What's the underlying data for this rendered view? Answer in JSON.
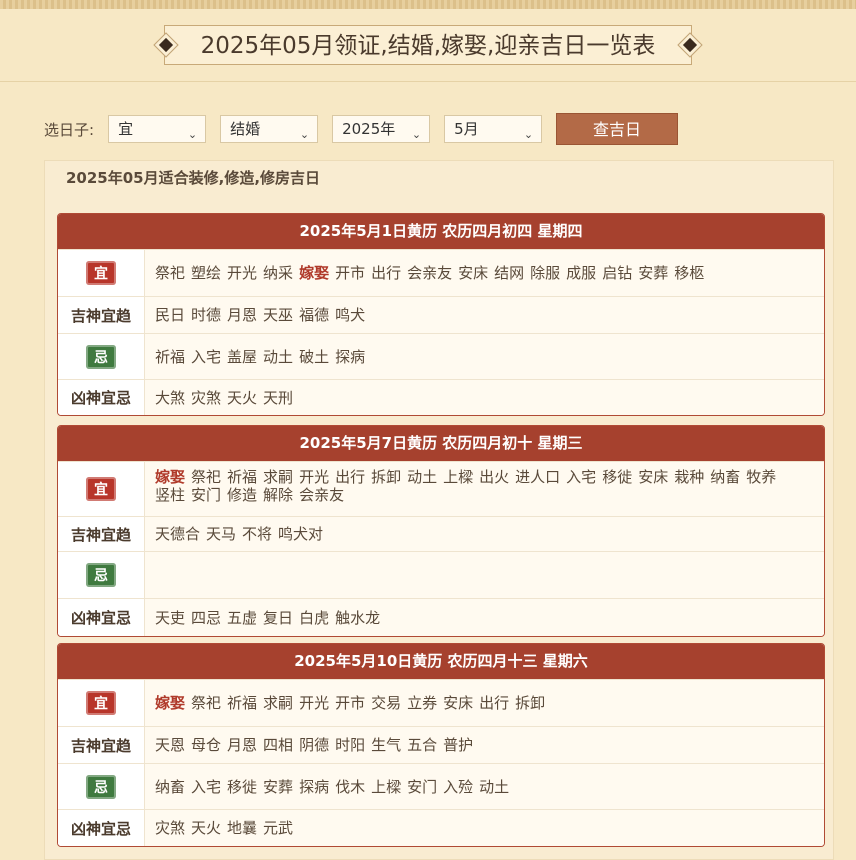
{
  "page": {
    "title": "2025年05月领证,结婚,嫁娶,迎亲吉日一览表"
  },
  "filter": {
    "label": "选日子:",
    "selects": [
      "宜",
      "结婚",
      "2025年",
      "5月"
    ],
    "button": "查吉日"
  },
  "panel": {
    "title": "2025年05月适合装修,修造,修房吉日"
  },
  "labels": {
    "yi": "宜",
    "ji": "忌",
    "jishen": "吉神宜趋",
    "xiongshen": "凶神宜忌"
  },
  "highlight_word": "嫁娶",
  "cards": [
    {
      "header": "2025年5月1日黄历  农历四月初四    星期四",
      "yi": [
        "祭祀",
        "塑绘",
        "开光",
        "纳采",
        "嫁娶",
        "开市",
        "出行",
        "会亲友",
        "安床",
        "结网",
        "除服",
        "成服",
        "启钻",
        "安葬",
        "移柩"
      ],
      "jishen": [
        "民日",
        "时德",
        "月恩",
        "天巫",
        "福德",
        "鸣犬"
      ],
      "ji": [
        "祈福",
        "入宅",
        "盖屋",
        "动土",
        "破土",
        "探病"
      ],
      "xiongshen": [
        "大煞",
        "灾煞",
        "天火",
        "天刑"
      ]
    },
    {
      "header": "2025年5月7日黄历  农历四月初十    星期三",
      "yi": [
        "嫁娶",
        "祭祀",
        "祈福",
        "求嗣",
        "开光",
        "出行",
        "拆卸",
        "动土",
        "上樑",
        "出火",
        "进人口",
        "入宅",
        "移徙",
        "安床",
        "栽种",
        "纳畜",
        "牧养",
        "竖柱",
        "安门",
        "修造",
        "解除",
        "会亲友"
      ],
      "jishen": [
        "天德合",
        "天马",
        "不将",
        "鸣犬对"
      ],
      "ji": [],
      "xiongshen": [
        "天吏",
        "四忌",
        "五虚",
        "复日",
        "白虎",
        "触水龙"
      ]
    },
    {
      "header": "2025年5月10日黄历  农历四月十三    星期六",
      "yi": [
        "嫁娶",
        "祭祀",
        "祈福",
        "求嗣",
        "开光",
        "开市",
        "交易",
        "立券",
        "安床",
        "出行",
        "拆卸"
      ],
      "jishen": [
        "天恩",
        "母仓",
        "月恩",
        "四相",
        "阴德",
        "时阳",
        "生气",
        "五合",
        "普护"
      ],
      "ji": [
        "纳畜",
        "入宅",
        "移徙",
        "安葬",
        "探病",
        "伐木",
        "上樑",
        "安门",
        "入殓",
        "动土"
      ],
      "xiongshen": [
        "灾煞",
        "天火",
        "地曩",
        "元武"
      ]
    }
  ]
}
